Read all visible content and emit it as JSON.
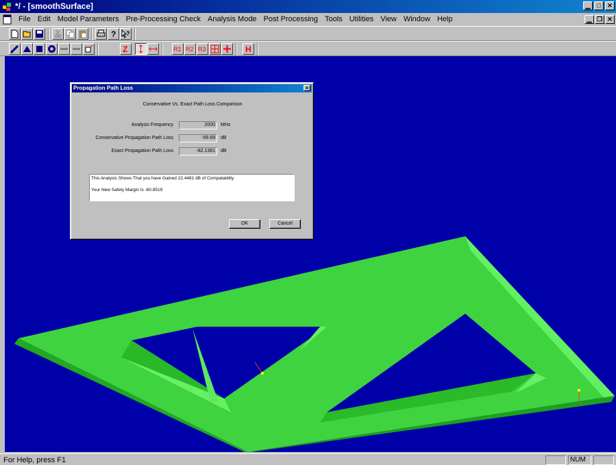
{
  "window": {
    "title": "*/ - [smoothSurface]"
  },
  "menu": [
    "File",
    "Edit",
    "Model Parameters",
    "Pre-Processing Check",
    "Analysis Mode",
    "Post Processing",
    "Tools",
    "Utilities",
    "View",
    "Window",
    "Help"
  ],
  "toolbar2": {
    "r1": "R1",
    "r2": "R2",
    "r3": "R3",
    "z": "Z",
    "h": "H"
  },
  "dialog": {
    "title": "Propagation Path Loss",
    "close": "×",
    "heading": "Conservative Vs. Exact Path Loss Comparison",
    "fields": [
      {
        "label": "Analysis Frequency",
        "value": "2000",
        "unit": "MHz"
      },
      {
        "label": "Conservative Propagation Path Loss",
        "value": "-59.69",
        "unit": "dB"
      },
      {
        "label": "Exact Propagation Path Loss",
        "value": "-82.1381",
        "unit": "dB"
      }
    ],
    "result_line1": "This Analysis Shows That you have Gained  22.4481  dB of Compatability",
    "result_line2": "Your New Safety Margin Is -60.8519",
    "ok_label": "OK",
    "cancel_label": "Cancel"
  },
  "status": {
    "help": "For Help, press F1",
    "num": "NUM"
  },
  "colors": {
    "workspace": "#0000a8",
    "model_green": "#33cc33",
    "titlebar": "#000080"
  }
}
